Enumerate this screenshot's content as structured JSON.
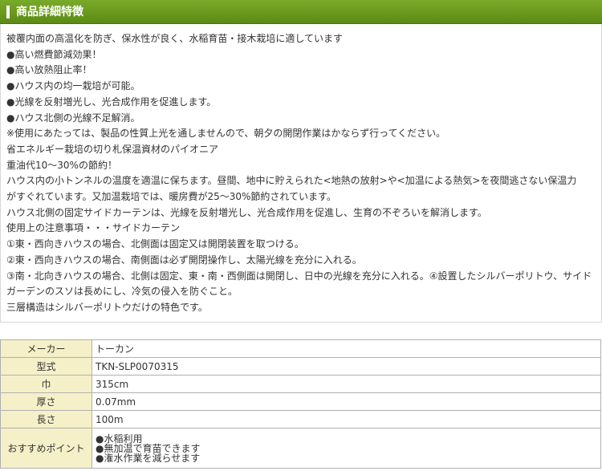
{
  "header": {
    "title": "商品詳細特徴"
  },
  "description": {
    "lines": [
      "被覆内面の高温化を防ぎ、保水性が良く、水稲育苗・接木栽培に適しています",
      "●高い燃費節減効果！",
      "●高い放熱阻止率！",
      "●ハウス内の均一栽培が可能。",
      "●光線を反射増光し、光合成作用を促進します。",
      "●ハウス北側の光線不足解消。",
      "※使用にあたっては、製品の性質上光を通しませんので、朝夕の開閉作業はかならず行ってください。",
      "省エネルギー栽培の切り札保温資材のパイオニア",
      "重油代10～30%の節約！",
      "ハウス内の小トンネルの温度を適温に保ちます。昼間、地中に貯えられた<地熱の放射>や<加温による熱気>を夜間逃さない保温力",
      "がすぐれています。又加温栽培では、暖房費が25～30%節約されています。",
      "ハウス北側の固定サイドカーテンは、光線を反射増光し、光合成作用を促進し、生育の不ぞろいを解消します。",
      "使用上の注意事項・・・サイドカーテン",
      "①東・西向きハウスの場合、北側面は固定又は開閉装置を取つける。",
      "②東・西向きハウスの場合、南側面は必ず開閉操作し、太陽光線を充分に入れる。",
      "③南・北向きハウスの場合、北側は固定、東・南・西側面は開閉し、日中の光線を充分に入れる。④設置したシルバーポリトウ、サイド",
      "ガーデンのスソは長めにし、冷気の侵入を防ぐこと。",
      "三層構造はシルバーポリトウだけの特色です。"
    ]
  },
  "specs": {
    "rows": [
      {
        "label": "メーカー",
        "value": "トーカン"
      },
      {
        "label": "型式",
        "value": "TKN-SLP0070315"
      },
      {
        "label": "巾",
        "value": "315cm"
      },
      {
        "label": "厚さ",
        "value": "0.07mm"
      },
      {
        "label": "長さ",
        "value": "100m"
      }
    ],
    "points": {
      "label": "おすすめポイント",
      "items": [
        "●水稲利用",
        "●無加温で育苗できます",
        "●潅水作業を減らせます"
      ]
    }
  },
  "colors": {
    "header_bg": "#5c8a14",
    "label_bg": "#f5f0c8",
    "border": "#b0b0b0"
  }
}
